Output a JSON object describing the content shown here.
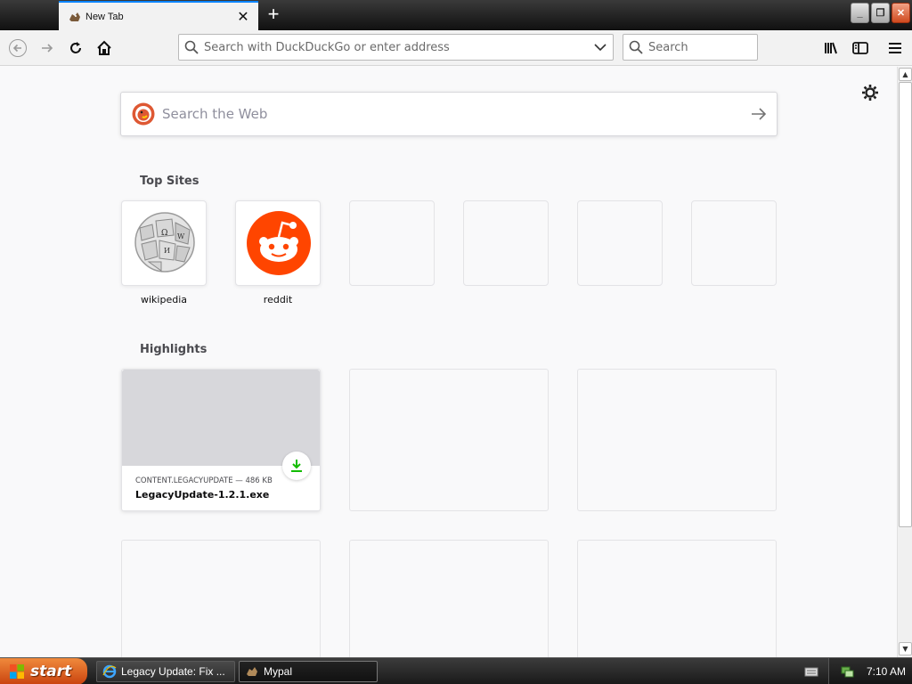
{
  "browser": {
    "tab": {
      "title": "New Tab",
      "close_glyph": "✕"
    },
    "new_tab_glyph": "+",
    "window_controls": {
      "minimize": "_",
      "restore": "❐",
      "close": "✕"
    },
    "urlbar": {
      "placeholder": "Search with DuckDuckGo or enter address"
    },
    "searchbar": {
      "placeholder": "Search"
    },
    "accent_color": "#0a84ff"
  },
  "newtab": {
    "web_search": {
      "placeholder": "Search the Web"
    },
    "top_sites": {
      "title": "Top Sites",
      "sites": [
        {
          "label": "wikipedia",
          "icon": "wikipedia-globe-icon"
        },
        {
          "label": "reddit",
          "icon": "reddit-alien-icon"
        },
        {
          "label": "",
          "icon": ""
        },
        {
          "label": "",
          "icon": ""
        },
        {
          "label": "",
          "icon": ""
        },
        {
          "label": "",
          "icon": ""
        }
      ]
    },
    "highlights": {
      "title": "Highlights",
      "cards": [
        {
          "meta": "CONTENT.LEGACYUPDATE — 486 KB",
          "title": "LegacyUpdate-1.2.1.exe",
          "badge": "download-icon"
        }
      ]
    }
  },
  "taskbar": {
    "start_label": "start",
    "items": [
      {
        "label": "Legacy Update: Fix ...",
        "icon": "internet-explorer-icon"
      },
      {
        "label": "Mypal",
        "icon": "mypal-icon"
      }
    ],
    "clock": "7:10 AM"
  }
}
